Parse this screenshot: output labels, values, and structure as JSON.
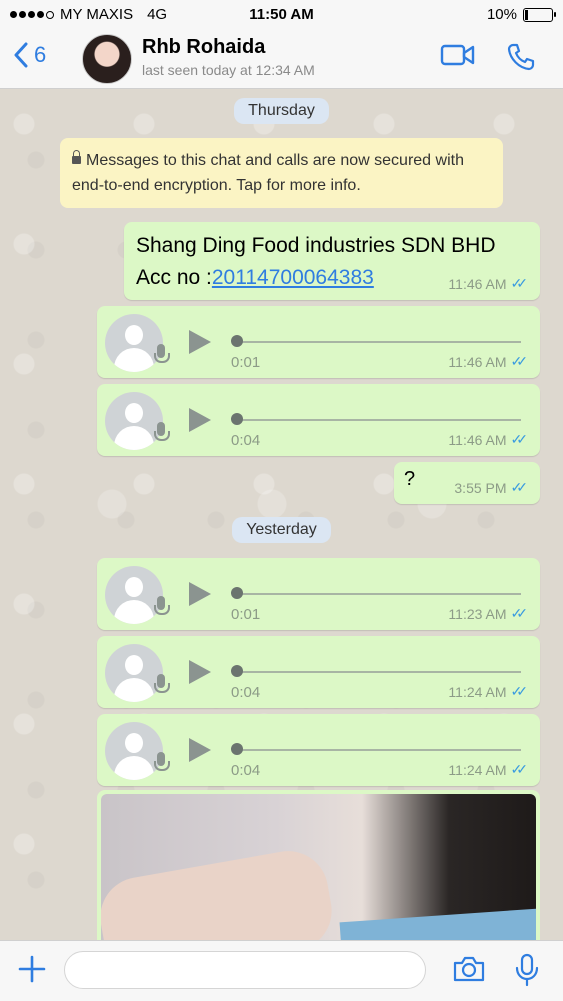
{
  "status_bar": {
    "carrier": "MY MAXIS",
    "network": "4G",
    "time": "11:50 AM",
    "battery": "10%"
  },
  "header": {
    "back_count": "6",
    "contact_name": "Rhb Rohaida",
    "last_seen": "last seen today at 12:34 AM"
  },
  "date_pills": {
    "thursday": "Thursday",
    "yesterday": "Yesterday"
  },
  "encryption_notice": "Messages to this chat and calls are now secured with end-to-end encryption. Tap for more info.",
  "messages": {
    "text1": {
      "line1": "Shang Ding Food industries SDN BHD",
      "acc_prefix": "Acc no :",
      "acc_link": "20114700064383",
      "time": "11:46 AM"
    },
    "voice1": {
      "duration": "0:01",
      "time": "11:46 AM"
    },
    "voice2": {
      "duration": "0:04",
      "time": "11:46 AM"
    },
    "text2": {
      "text": "?",
      "time": "3:55 PM"
    },
    "voice3": {
      "duration": "0:01",
      "time": "11:23 AM"
    },
    "voice4": {
      "duration": "0:04",
      "time": "11:24 AM"
    },
    "voice5": {
      "duration": "0:04",
      "time": "11:24 AM"
    }
  },
  "composer": {
    "placeholder": ""
  },
  "colors": {
    "accent": "#2f7de0",
    "bubble_out": "#dcf8c6",
    "ticks": "#3a9be0"
  },
  "icons": [
    "back-chevron-icon",
    "video-call-icon",
    "phone-call-icon",
    "plus-icon",
    "camera-icon",
    "microphone-icon",
    "play-icon",
    "lock-icon",
    "double-check-icon"
  ]
}
